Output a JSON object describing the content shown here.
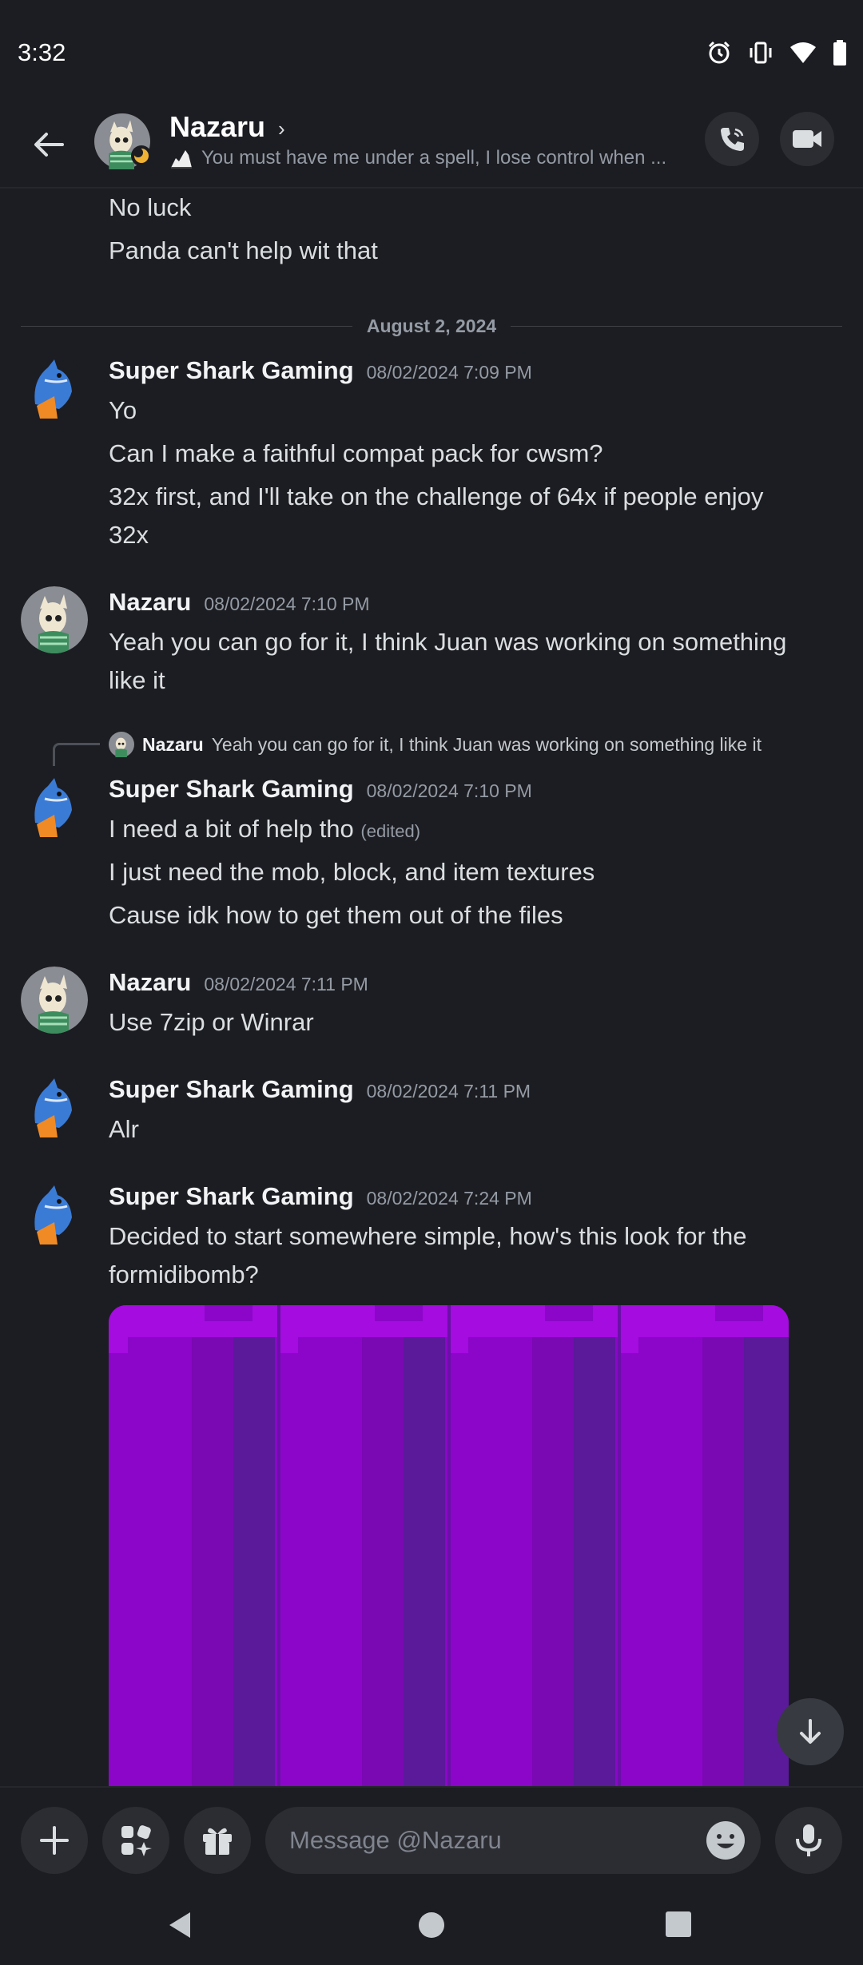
{
  "status_bar": {
    "time": "3:32"
  },
  "header": {
    "name": "Nazaru",
    "chevron": "›",
    "custom_status": "You must have me under a spell, I lose control when ..."
  },
  "messages": {
    "prev_lines": [
      "No luck",
      "Panda can't help wit that"
    ],
    "date_divider": "August 2, 2024",
    "groups": [
      {
        "author": "Super Shark Gaming",
        "timestamp": "08/02/2024 7:09 PM",
        "lines": [
          "Yo",
          "Can I make a faithful compat pack for cwsm?",
          "32x first, and I'll take on the challenge of 64x if people enjoy",
          "32x"
        ]
      },
      {
        "author": "Nazaru",
        "timestamp": "08/02/2024 7:10 PM",
        "lines": [
          "Yeah you can go for it, I think Juan was working on something",
          "like it"
        ]
      },
      {
        "reply_to": {
          "name": "Nazaru",
          "text": "Yeah you can go for it, I think Juan was working on something like it"
        },
        "author": "Super Shark Gaming",
        "timestamp": "08/02/2024 7:10 PM",
        "lines": [
          "I need a bit of help tho",
          "I just need the mob, block, and item textures",
          "Cause idk how to get them out of the files"
        ],
        "edited": "(edited)"
      },
      {
        "author": "Nazaru",
        "timestamp": "08/02/2024 7:11 PM",
        "lines": [
          "Use 7zip or Winrar"
        ]
      },
      {
        "author": "Super Shark Gaming",
        "timestamp": "08/02/2024 7:11 PM",
        "lines": [
          "Alr"
        ]
      },
      {
        "author": "Super Shark Gaming",
        "timestamp": "08/02/2024 7:24 PM",
        "lines": [
          "Decided to start somewhere simple, how's this look for the",
          "formidibomb?"
        ],
        "attachment": "image"
      }
    ]
  },
  "composer": {
    "placeholder": "Message @Nazaru"
  },
  "icons": {
    "back": "arrow-left-icon",
    "call": "phone-icon",
    "video": "video-camera-icon",
    "add": "plus-icon",
    "apps": "apps-icon",
    "gift": "gift-icon",
    "emoji": "emoji-icon",
    "mic": "microphone-icon",
    "scroll_down": "arrow-down-icon"
  },
  "colors": {
    "background": "#1c1d22",
    "text": "#dbdee1",
    "muted": "#949ba4",
    "shark_blue": "#3a7bd5",
    "shark_orange": "#f08a24",
    "image_purple": "#8c06c9"
  }
}
